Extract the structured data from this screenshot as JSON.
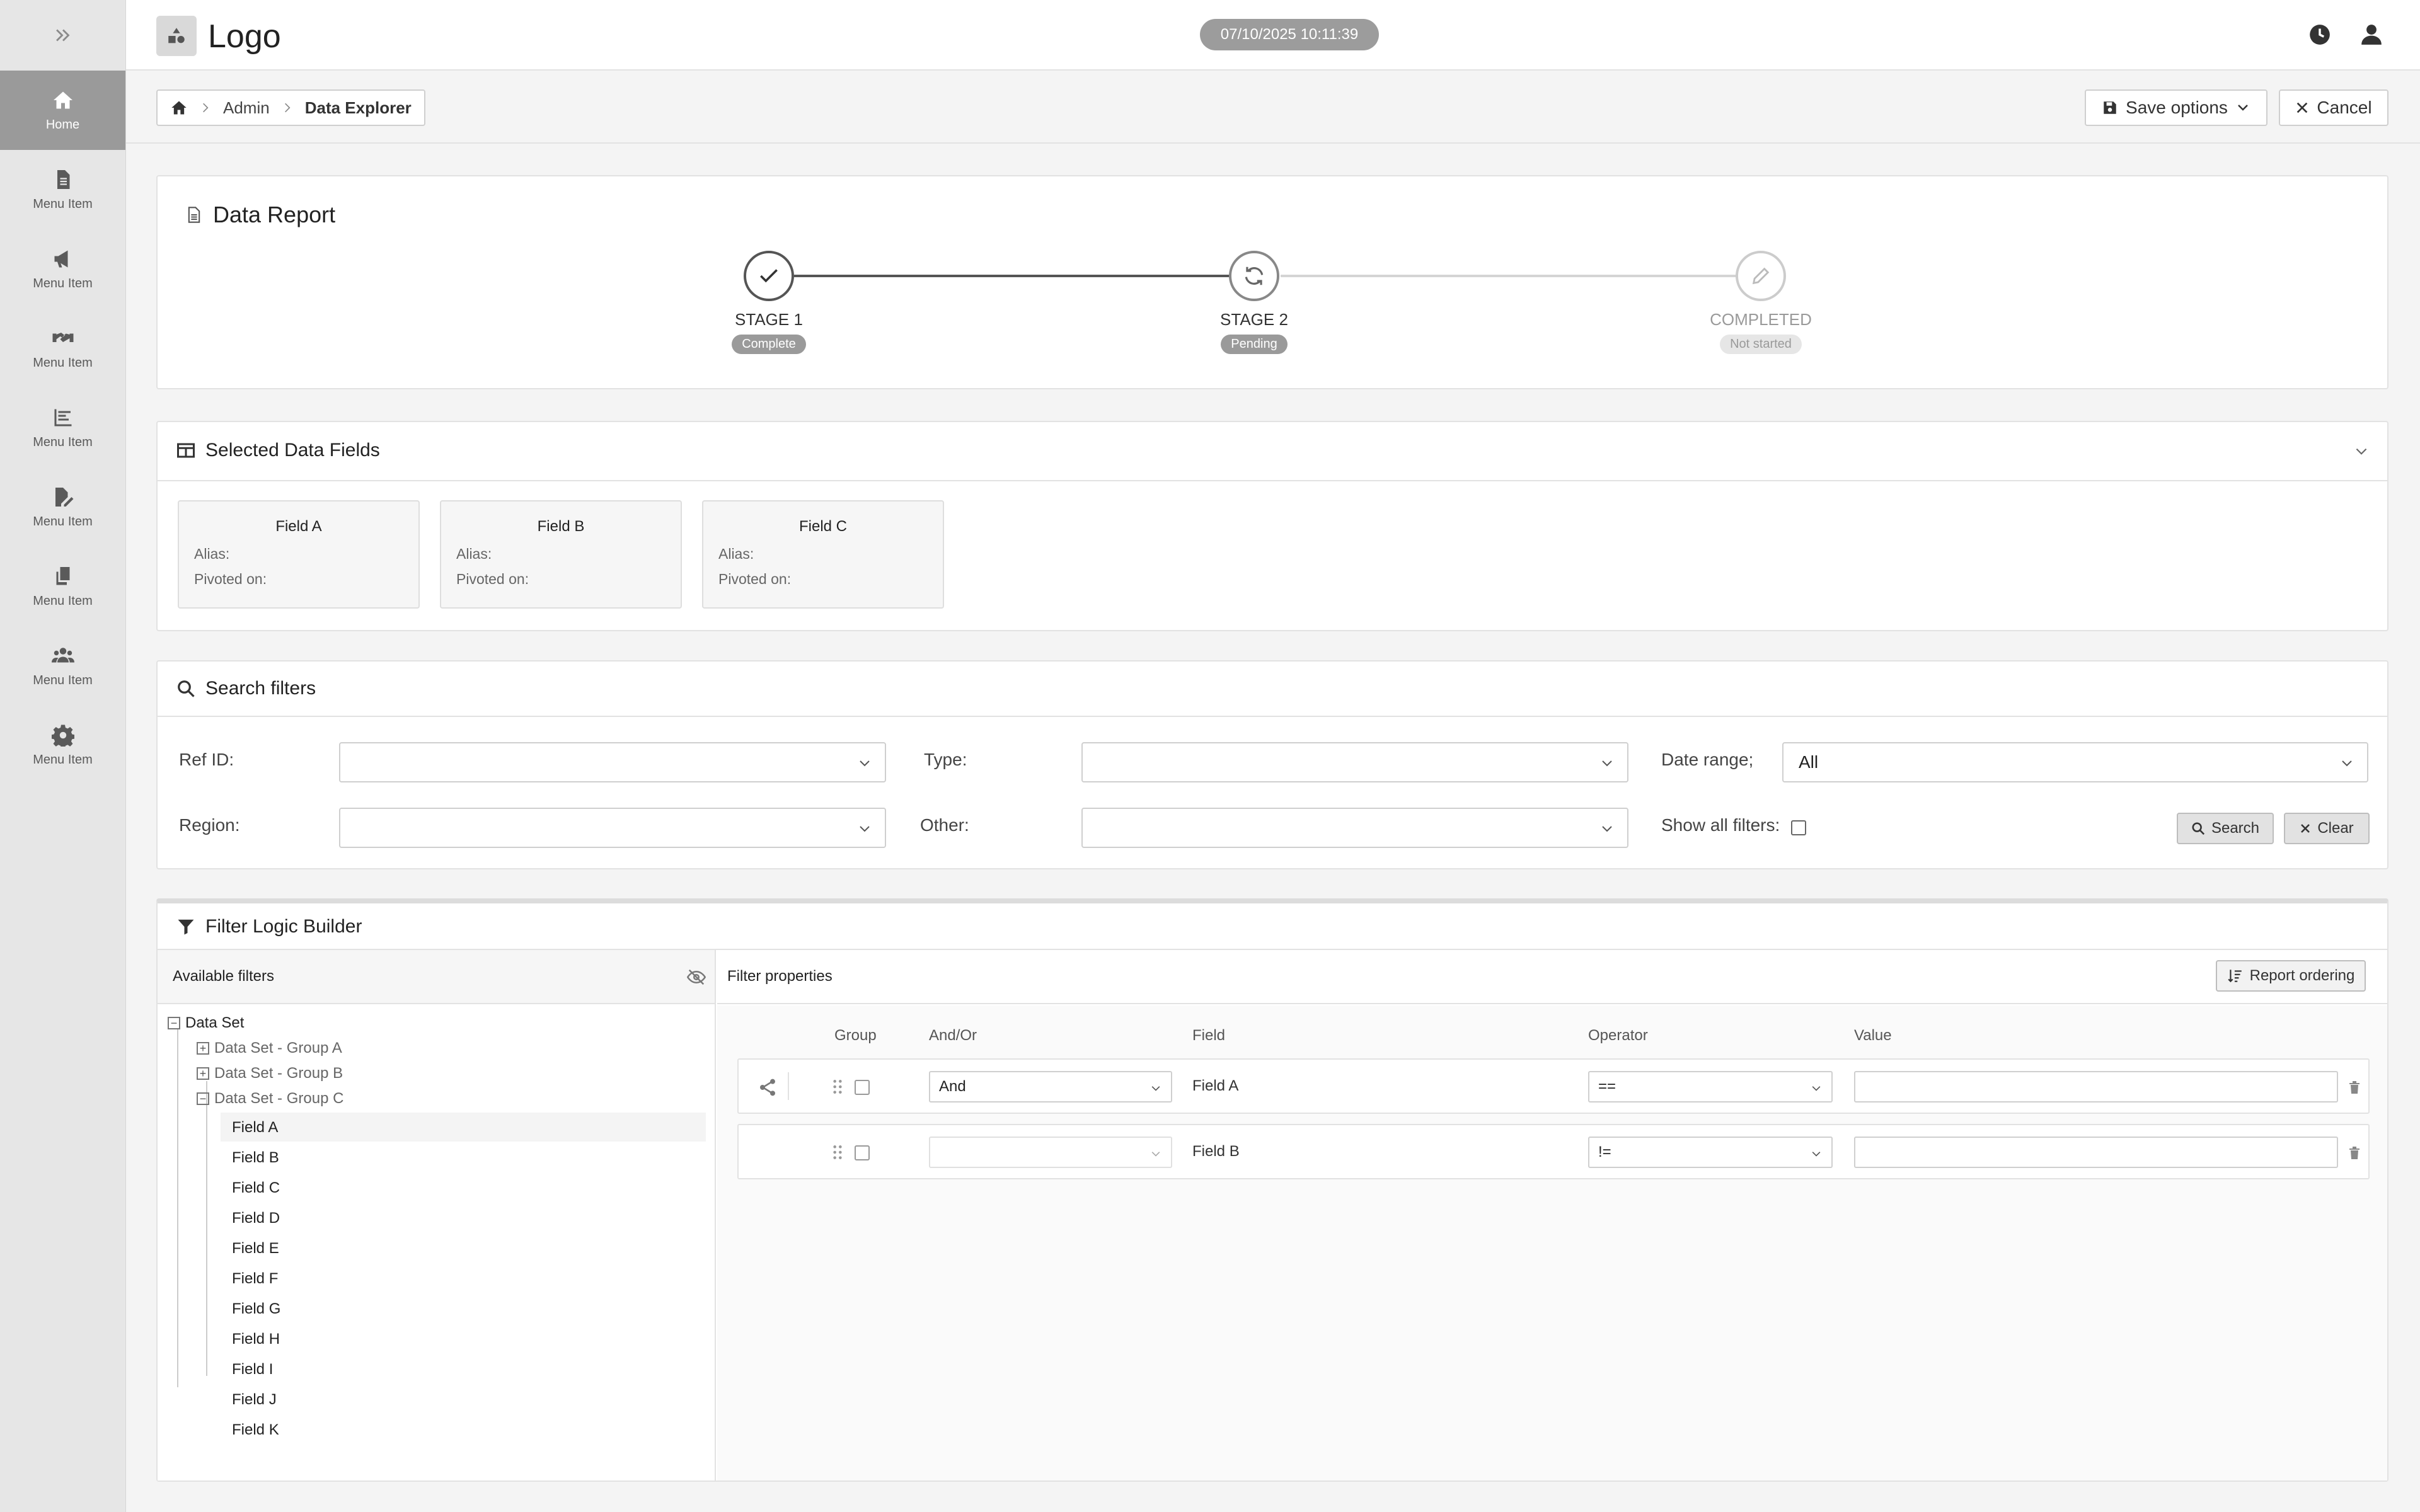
{
  "sidebar": {
    "items": [
      {
        "label": "Home",
        "icon": "home-icon"
      },
      {
        "label": "Menu Item",
        "icon": "document-icon"
      },
      {
        "label": "Menu Item",
        "icon": "megaphone-icon"
      },
      {
        "label": "Menu Item",
        "icon": "handshake-icon"
      },
      {
        "label": "Menu Item",
        "icon": "bar-chart-icon"
      },
      {
        "label": "Menu Item",
        "icon": "edit-file-icon"
      },
      {
        "label": "Menu Item",
        "icon": "copy-icon"
      },
      {
        "label": "Menu Item",
        "icon": "users-icon"
      },
      {
        "label": "Menu Item",
        "icon": "gear-icon"
      }
    ]
  },
  "header": {
    "logo_text": "Logo",
    "timestamp": "07/10/2025 10:11:39"
  },
  "breadcrumb": {
    "items": [
      "Admin",
      "Data Explorer"
    ]
  },
  "toolbar": {
    "save_label": "Save options",
    "cancel_label": "Cancel"
  },
  "report": {
    "title": "Data Report",
    "stages": [
      {
        "label": "STAGE 1",
        "status": "Complete"
      },
      {
        "label": "STAGE 2",
        "status": "Pending"
      },
      {
        "label": "COMPLETED",
        "status": "Not started"
      }
    ]
  },
  "selected_fields": {
    "title": "Selected Data Fields",
    "alias_label": "Alias:",
    "pivot_label": "Pivoted on:",
    "fields": [
      "Field A",
      "Field B",
      "Field C"
    ]
  },
  "search_filters": {
    "title": "Search filters",
    "ref_id_label": "Ref ID:",
    "type_label": "Type:",
    "date_range_label": "Date range;",
    "date_range_value": "All",
    "region_label": "Region:",
    "other_label": "Other:",
    "show_all_label": "Show all filters:",
    "search_label": "Search",
    "clear_label": "Clear"
  },
  "filter_builder": {
    "title": "Filter Logic Builder",
    "available_title": "Available filters",
    "properties_title": "Filter properties",
    "report_ordering_label": "Report ordering",
    "tree": {
      "root": "Data Set",
      "groups": [
        "Data Set - Group A",
        "Data Set - Group B",
        "Data Set - Group C"
      ],
      "fields": [
        "Field A",
        "Field B",
        "Field C",
        "Field D",
        "Field E",
        "Field F",
        "Field G",
        "Field H",
        "Field I",
        "Field J",
        "Field K"
      ]
    },
    "columns": [
      "Group",
      "And/Or",
      "Field",
      "Operator",
      "Value"
    ],
    "rules": [
      {
        "andor": "And",
        "field": "Field A",
        "operator": "=="
      },
      {
        "andor": "",
        "field": "Field B",
        "operator": "!="
      }
    ]
  }
}
